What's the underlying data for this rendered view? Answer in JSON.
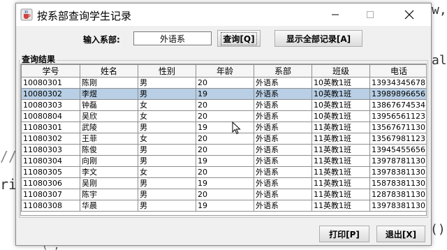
{
  "background_code": {
    "frag1": "w,",
    "frag2": "alu",
    "frag3": "//",
    "frag4": "ri",
    "frag5": "()",
    "frag6": "( ,"
  },
  "window": {
    "title": "按系部查询学生记录",
    "icon": "java-coffee-icon"
  },
  "query": {
    "label": "输入系部:",
    "input_value": "外语系",
    "query_button": "查询[Q]",
    "show_all_button": "显示全部记录[A]"
  },
  "results": {
    "title": "查询结果",
    "columns": [
      "学号",
      "姓名",
      "性别",
      "年龄",
      "系部",
      "班级",
      "电话"
    ],
    "rows": [
      [
        "10080301",
        "陈刚",
        "男",
        "20",
        "外语系",
        "10英教1班",
        "13934345678"
      ],
      [
        "10080302",
        "李煜",
        "男",
        "19",
        "外语系",
        "10英教1班",
        "13989896656"
      ],
      [
        "10080303",
        "钟磊",
        "女",
        "20",
        "外语系",
        "10英教1班",
        "13867674534"
      ],
      [
        "10080804",
        "吴欣",
        "女",
        "20",
        "外语系",
        "10英教1班",
        "13956561123"
      ],
      [
        "11080301",
        "武陵",
        "男",
        "19",
        "外语系",
        "11英教1班",
        "13567671130"
      ],
      [
        "11080302",
        "王菲",
        "女",
        "20",
        "外语系",
        "11英教1班",
        "13567981123"
      ],
      [
        "11080303",
        "陈俊",
        "男",
        "20",
        "外语系",
        "11英教1班",
        "13945455656"
      ],
      [
        "11080304",
        "向刚",
        "男",
        "19",
        "外语系",
        "11英教1班",
        "13978781130"
      ],
      [
        "11080305",
        "李文",
        "女",
        "20",
        "外语系",
        "11英教1班",
        "13978381130"
      ],
      [
        "11080306",
        "吴刚",
        "男",
        "19",
        "外语系",
        "11英教1班",
        "15878381130"
      ],
      [
        "11080307",
        "陈宇",
        "男",
        "20",
        "外语系",
        "11英教1班",
        "12878381130"
      ],
      [
        "11080308",
        "华晨",
        "男",
        "19",
        "外语系",
        "11英教1班",
        "13978381130"
      ]
    ],
    "selected_row_index": 1
  },
  "footer": {
    "print_button": "打印[P]",
    "exit_button": "退出[X]"
  },
  "colors": {
    "selection": "#b8cfe5",
    "window_bg": "#f0f0f0"
  }
}
